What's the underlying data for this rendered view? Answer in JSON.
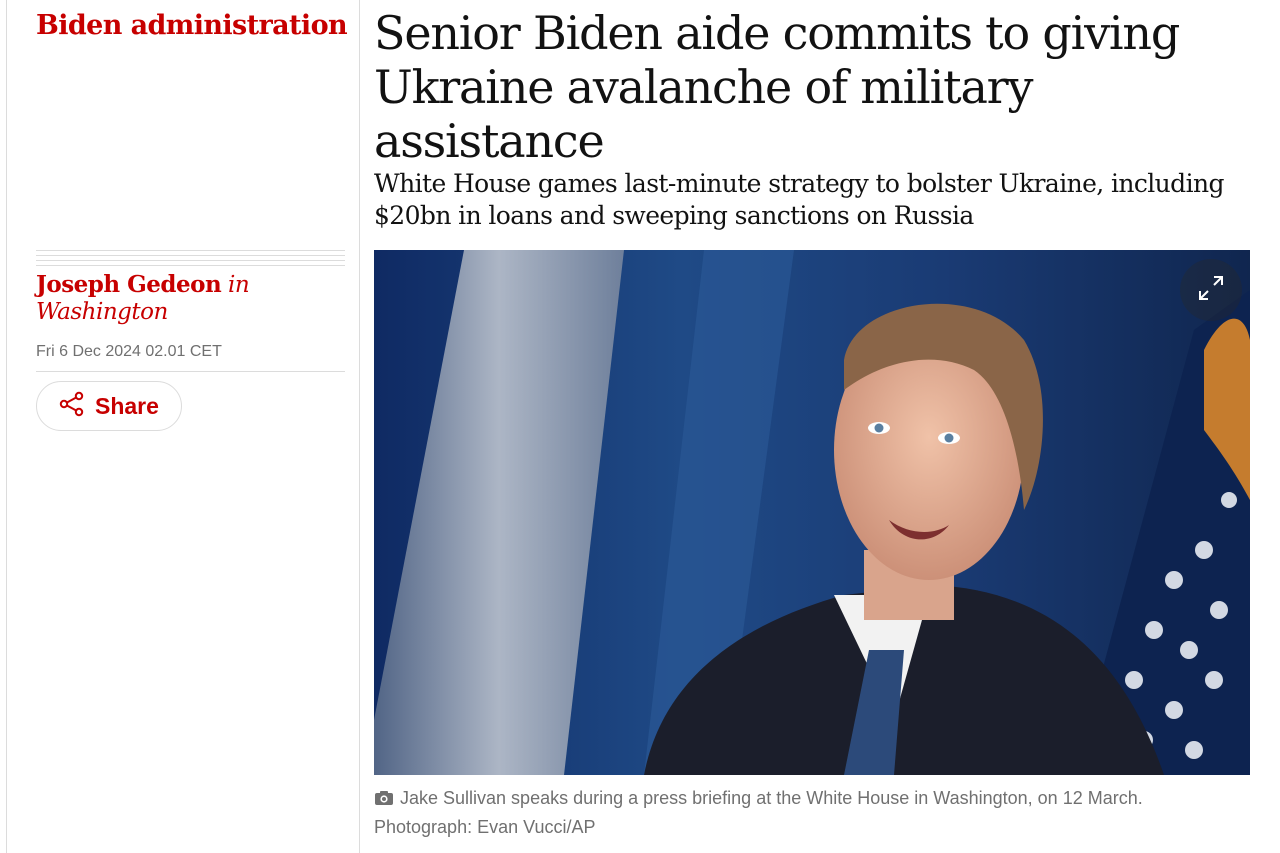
{
  "section": {
    "label": "Biden administration"
  },
  "article": {
    "headline": "Senior Biden aide commits to giving Ukraine avalanche of military assistance",
    "standfirst": "White House games last-minute strategy to bolster Ukraine, including $20bn in loans and sweeping sanctions on Russia"
  },
  "meta": {
    "author": "Joseph Gedeon",
    "in_word": "in",
    "location": "Washington",
    "date": "Fri 6 Dec 2024 02.01 CET",
    "share_label": "Share"
  },
  "image": {
    "caption": "Jake Sullivan speaks during a press briefing at the White House in Washington, on 12 March.",
    "credit": "Photograph: Evan Vucci/AP"
  },
  "icons": {
    "share": "share-icon",
    "expand": "expand-icon",
    "camera": "camera-icon"
  },
  "colors": {
    "accent": "#c70000",
    "text": "#121212",
    "muted": "#707070",
    "rule": "#dcdcdc"
  }
}
